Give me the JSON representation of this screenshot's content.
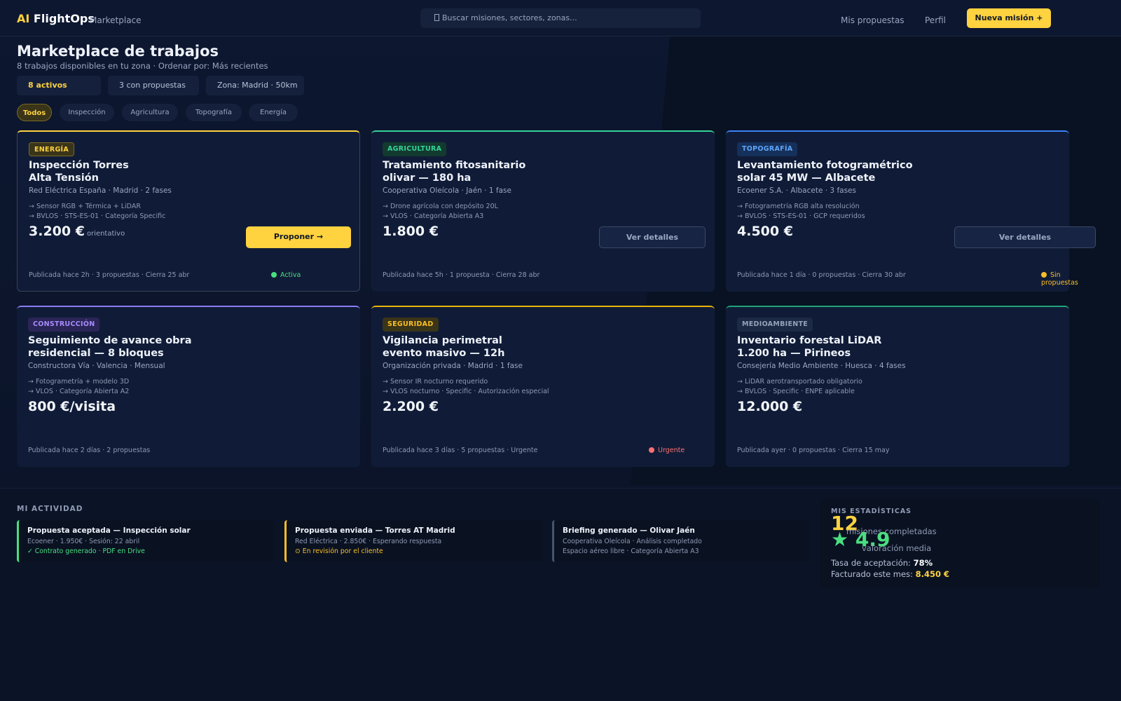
{
  "header": {
    "brand_ai": "AI",
    "brand_name": "FlightOps",
    "brand_sub": "Marketplace",
    "search_placeholder": "Buscar misiones, sectores, zonas...",
    "nav": [
      "Mis propuestas",
      "Perfil"
    ],
    "cta": "Nueva misión +"
  },
  "page": {
    "title": "Marketplace de trabajos",
    "subtitle": "8 trabajos disponibles en tu zona · Ordenar por: Más recientes",
    "stats": [
      "8 activos",
      "3 con propuestas",
      "Zona: Madrid · 50km"
    ],
    "filters": [
      "Todos",
      "Inspección",
      "Agricultura",
      "Topografía",
      "Energía"
    ],
    "active_filter": "Todos"
  },
  "jobs": [
    {
      "badge": "ENERGÍA",
      "title": "Inspección Torres\nAlta Tensión",
      "meta": "Red Eléctrica España · Madrid · 2 fases",
      "bullets": [
        "→ Sensor RGB + Térmica + LiDAR",
        "→ BVLOS · STS-ES-01 · Categoría Specific"
      ],
      "price": "3.200 €",
      "price_note": "orientativo",
      "button": "Proponer →",
      "footer": "Publicada hace 2h · 3 propuestas · Cierra 25 abr",
      "status": "Activa",
      "accent": "#ffd23f"
    },
    {
      "badge": "AGRICULTURA",
      "title": "Tratamiento fitosanitario\nolivar — 180 ha",
      "meta": "Cooperativa Oleícola · Jaén · 1 fase",
      "bullets": [
        "→ Drone agrícola con depósito 20L",
        "→ VLOS · Categoría Abierta A3"
      ],
      "price": "1.800 €",
      "button": "Ver detalles",
      "footer": "Publicada hace 5h · 1 propuesta · Cierra 28 abr",
      "accent": "#34d399"
    },
    {
      "badge": "TOPOGRAFÍA",
      "title": "Levantamiento fotogramétrico\nsolar 45 MW — Albacete",
      "meta": "Ecoener S.A. · Albacete · 3 fases",
      "bullets": [
        "→ Fotogrametría RGB alta resolución",
        "→ BVLOS · STS-ES-01 · GCP requeridos"
      ],
      "price": "4.500 €",
      "button": "Ver detalles",
      "footer": "Publicada hace 1 día · 0 propuestas · Cierra 30 abr",
      "status": "Sin propuestas",
      "accent": "#3b82f6"
    },
    {
      "badge": "CONSTRUCCIÓN",
      "title": "Seguimiento de avance obra\nresidencial — 8 bloques",
      "meta": "Constructora Vía · Valencia · Mensual",
      "bullets": [
        "→ Fotogrametría + modelo 3D",
        "→ VLOS · Categoría Abierta A2"
      ],
      "price": "800 €/visita",
      "footer": "Publicada hace 2 días · 2 propuestas",
      "accent": "#8b7cf6"
    },
    {
      "badge": "SEGURIDAD",
      "title": "Vigilancia perimetral\nevento masivo — 12h",
      "meta": "Organización privada · Madrid · 1 fase",
      "bullets": [
        "→ Sensor IR nocturno requerido",
        "→ VLOS nocturno · Specific · Autorización especial"
      ],
      "price": "2.200 €",
      "footer": "Publicada hace 3 días · 5 propuestas · Urgente",
      "status": "Urgente",
      "accent": "#eab308"
    },
    {
      "badge": "MEDIOAMBIENTE",
      "title": "Inventario forestal LiDAR\n1.200 ha — Pirineos",
      "meta": "Consejería Medio Ambiente · Huesca · 4 fases",
      "bullets": [
        "→ LiDAR aerotransportado obligatorio",
        "→ BVLOS · Specific · ENPE aplicable"
      ],
      "price": "12.000 €",
      "footer": "Publicada ayer · 0 propuestas · Cierra 15 may",
      "accent": "#22a37a"
    }
  ],
  "activity": {
    "label": "MI ACTIVIDAD",
    "items": [
      {
        "title": "Propuesta aceptada — Inspección solar",
        "line1": "Ecoener · 1.950€ · Sesión: 22 abril",
        "line2": "✓ Contrato generado · PDF en Drive"
      },
      {
        "title": "Propuesta enviada — Torres AT Madrid",
        "line1": "Red Eléctrica · 2.850€ · Esperando respuesta",
        "line2": "⊙ En revisión por el cliente"
      },
      {
        "title": "Briefing generado — Olivar Jaén",
        "line1": "Cooperativa Oleícola · Análisis completado",
        "line2": "Espacio aéreo libre · Categoría Abierta A3"
      }
    ]
  },
  "stats": {
    "label": "MIS ESTADÍSTICAS",
    "missions": "12",
    "missions_label": "misiones completadas",
    "rating": "★ 4.9",
    "rating_label": "valoración media",
    "acceptance_label": "Tasa de aceptación:",
    "acceptance_value": "78%",
    "billing_label": "Facturado este mes:",
    "billing_value": "8.450 €"
  },
  "colors": {
    "accent": "#ffd23f",
    "green": "#4ade80",
    "red": "#f87171",
    "yellow": "#fbbf24",
    "slate": "#475569"
  }
}
